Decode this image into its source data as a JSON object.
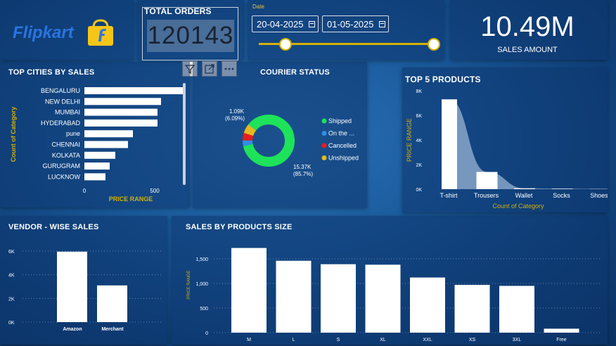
{
  "brand": {
    "name": "Flipkart"
  },
  "total_orders": {
    "title": "TOTAL ORDERS",
    "value": "120143"
  },
  "date_filter": {
    "label": "Date",
    "start": "20-04-2025",
    "end": "01-05-2025"
  },
  "sales_amount": {
    "value": "10.49M",
    "label": "SALES AMOUNT"
  },
  "visual_toolbar": {
    "icons": [
      "filter-icon",
      "focus-mode-icon",
      "more-options-icon"
    ]
  },
  "colors": {
    "accent_yellow": "#d4b106",
    "shipped": "#1ee25a",
    "on_the_way": "#2f8fe6",
    "cancelled": "#e81c1c",
    "unshipped": "#e6b820"
  },
  "top_cities": {
    "title": "TOP CITIES BY SALES",
    "ylabel": "Count of Category",
    "xlabel": "PRICE RANGE",
    "ticks": [
      "0",
      "500"
    ],
    "categories": [
      "BENGALURU",
      "NEW DELHI",
      "MUMBAI",
      "HYDERABAD",
      "pune",
      "CHENNAI",
      "KOLKATA",
      "GURUGRAM",
      "LUCKNOW"
    ]
  },
  "courier": {
    "title": "COURIER STATUS",
    "label_small": [
      "1.09K",
      "(6.09%)"
    ],
    "label_big": [
      "15.37K",
      "(85.7%)"
    ],
    "legend": [
      "Shipped",
      "On the ...",
      "Cancelled",
      "Unshipped"
    ]
  },
  "top_products": {
    "title": "TOP 5 PRODUCTS",
    "ylabel": "PRICE RANGE",
    "xlabel": "Count of Category",
    "yticks": [
      "0K",
      "2K",
      "4K",
      "6K",
      "8K"
    ],
    "categories": [
      "T-shirt",
      "Trousers",
      "Wallet",
      "Socks",
      "Shoes"
    ]
  },
  "vendor": {
    "title": "VENDOR - WISE SALES",
    "yticks": [
      "0K",
      "2K",
      "4K",
      "6K"
    ],
    "categories": [
      "Amazon",
      "Merchant"
    ]
  },
  "size_sales": {
    "title": "SALES BY PRODUCTS SIZE",
    "ylabel": "PRICE RANGE",
    "yticks": [
      "0",
      "500",
      "1,000",
      "1,500"
    ],
    "categories": [
      "M",
      "L",
      "S",
      "XL",
      "XXL",
      "XS",
      "3XL",
      "Free"
    ]
  },
  "chart_data": [
    {
      "type": "bar",
      "orientation": "horizontal",
      "title": "TOP CITIES BY SALES",
      "xlabel": "PRICE RANGE",
      "ylabel": "Count of Category",
      "categories": [
        "BENGALURU",
        "NEW DELHI",
        "MUMBAI",
        "HYDERABAD",
        "pune",
        "CHENNAI",
        "KOLKATA",
        "GURUGRAM",
        "LUCKNOW"
      ],
      "values": [
        720,
        545,
        520,
        520,
        345,
        310,
        220,
        180,
        150
      ],
      "xlim": [
        0,
        800
      ]
    },
    {
      "type": "pie",
      "title": "COURIER STATUS",
      "categories": [
        "Shipped",
        "On the ...",
        "Cancelled",
        "Unshipped"
      ],
      "values": [
        15370,
        640,
        830,
        1090
      ]
    },
    {
      "type": "bar",
      "title": "TOP 5 PRODUCTS",
      "xlabel": "Count of Category",
      "ylabel": "PRICE RANGE",
      "categories": [
        "T-shirt",
        "Trousers",
        "Wallet",
        "Socks",
        "Shoes"
      ],
      "values": [
        7300,
        1400,
        70,
        40,
        20
      ],
      "ylim": [
        0,
        8000
      ]
    },
    {
      "type": "bar",
      "title": "VENDOR - WISE SALES",
      "categories": [
        "Amazon",
        "Merchant"
      ],
      "values": [
        5950,
        3100
      ],
      "ylim": [
        0,
        6500
      ]
    },
    {
      "type": "bar",
      "title": "SALES BY PRODUCTS SIZE",
      "ylabel": "PRICE RANGE",
      "categories": [
        "M",
        "L",
        "S",
        "XL",
        "XXL",
        "XS",
        "3XL",
        "Free"
      ],
      "values": [
        1720,
        1460,
        1390,
        1380,
        1120,
        970,
        950,
        80
      ],
      "ylim": [
        0,
        1800
      ]
    }
  ]
}
